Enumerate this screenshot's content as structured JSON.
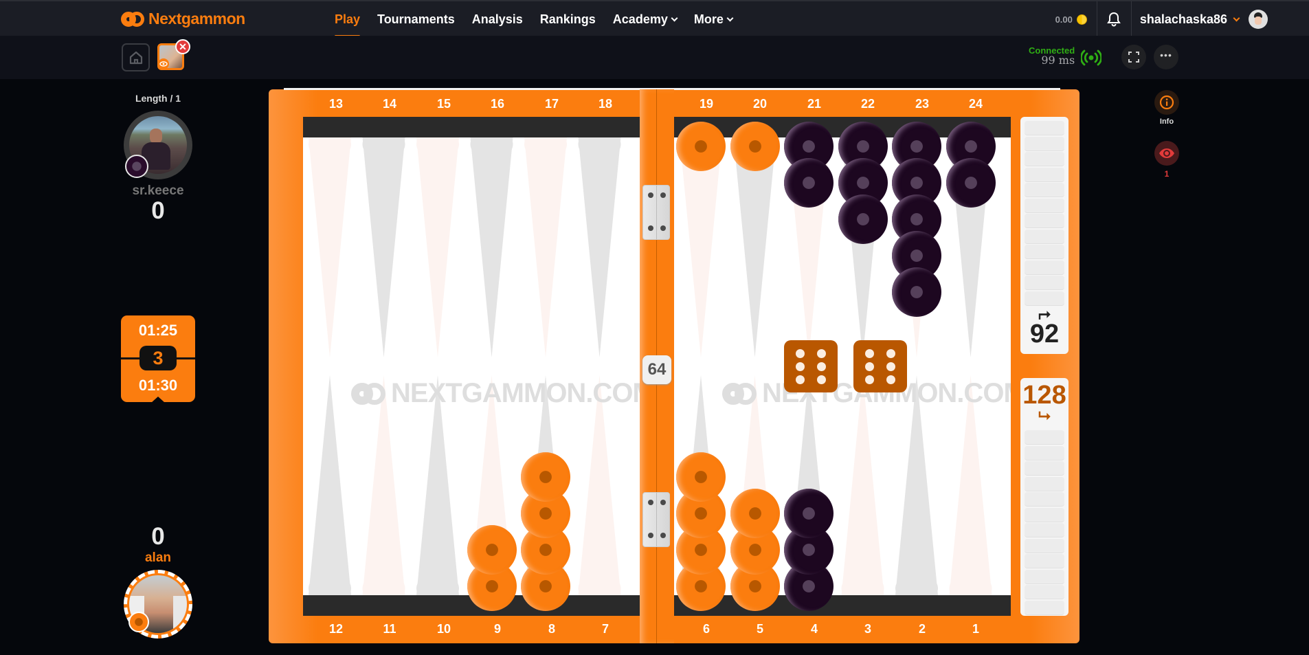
{
  "topnav": {
    "brand": "Nextgammon",
    "items": [
      {
        "label": "Play",
        "active": true,
        "dropdown": false
      },
      {
        "label": "Tournaments",
        "active": false,
        "dropdown": false
      },
      {
        "label": "Analysis",
        "active": false,
        "dropdown": false
      },
      {
        "label": "Rankings",
        "active": false,
        "dropdown": false
      },
      {
        "label": "Academy",
        "active": false,
        "dropdown": true
      },
      {
        "label": "More",
        "active": false,
        "dropdown": true
      }
    ],
    "balance": "0.00",
    "username": "shalachaska86"
  },
  "subbar": {
    "connection_status": "Connected",
    "latency": "99 ms"
  },
  "sidebar_right": {
    "info_label": "Info",
    "spectators_count": "1"
  },
  "match": {
    "length_label": "Length / 1",
    "top_player": {
      "name": "sr.keece",
      "score": "0",
      "color": "dark"
    },
    "bottom_player": {
      "name": "alan",
      "score": "0",
      "color": "orange"
    },
    "clock": {
      "top_time": "01:25",
      "bottom_time": "01:30",
      "cube_value": "3"
    }
  },
  "board": {
    "top_points_left": [
      "13",
      "14",
      "15",
      "16",
      "17",
      "18"
    ],
    "top_points_right": [
      "19",
      "20",
      "21",
      "22",
      "23",
      "24"
    ],
    "bottom_points_left": [
      "12",
      "11",
      "10",
      "9",
      "8",
      "7"
    ],
    "bottom_points_right": [
      "6",
      "5",
      "4",
      "3",
      "2",
      "1"
    ],
    "watermark": "NEXTGAMMON.COM",
    "bar_cube_value": "64",
    "dice": [
      6,
      6
    ],
    "top_pip_count": "92",
    "bottom_pip_count": "128",
    "checkers": [
      {
        "point": 19,
        "color": "orange",
        "count": 1
      },
      {
        "point": 20,
        "color": "orange",
        "count": 1
      },
      {
        "point": 21,
        "color": "dark",
        "count": 2
      },
      {
        "point": 22,
        "color": "dark",
        "count": 3
      },
      {
        "point": 23,
        "color": "dark",
        "count": 5
      },
      {
        "point": 24,
        "color": "dark",
        "count": 2
      },
      {
        "point": 9,
        "color": "orange",
        "count": 2
      },
      {
        "point": 8,
        "color": "orange",
        "count": 4
      },
      {
        "point": 6,
        "color": "orange",
        "count": 4
      },
      {
        "point": 5,
        "color": "orange",
        "count": 3
      },
      {
        "point": 4,
        "color": "dark",
        "count": 3
      }
    ]
  },
  "colors": {
    "accent": "#fb7d0f",
    "dark_checker": "#1d0720",
    "die": "#b95700",
    "connected": "#2fae14",
    "spectator": "#e23b3b"
  }
}
